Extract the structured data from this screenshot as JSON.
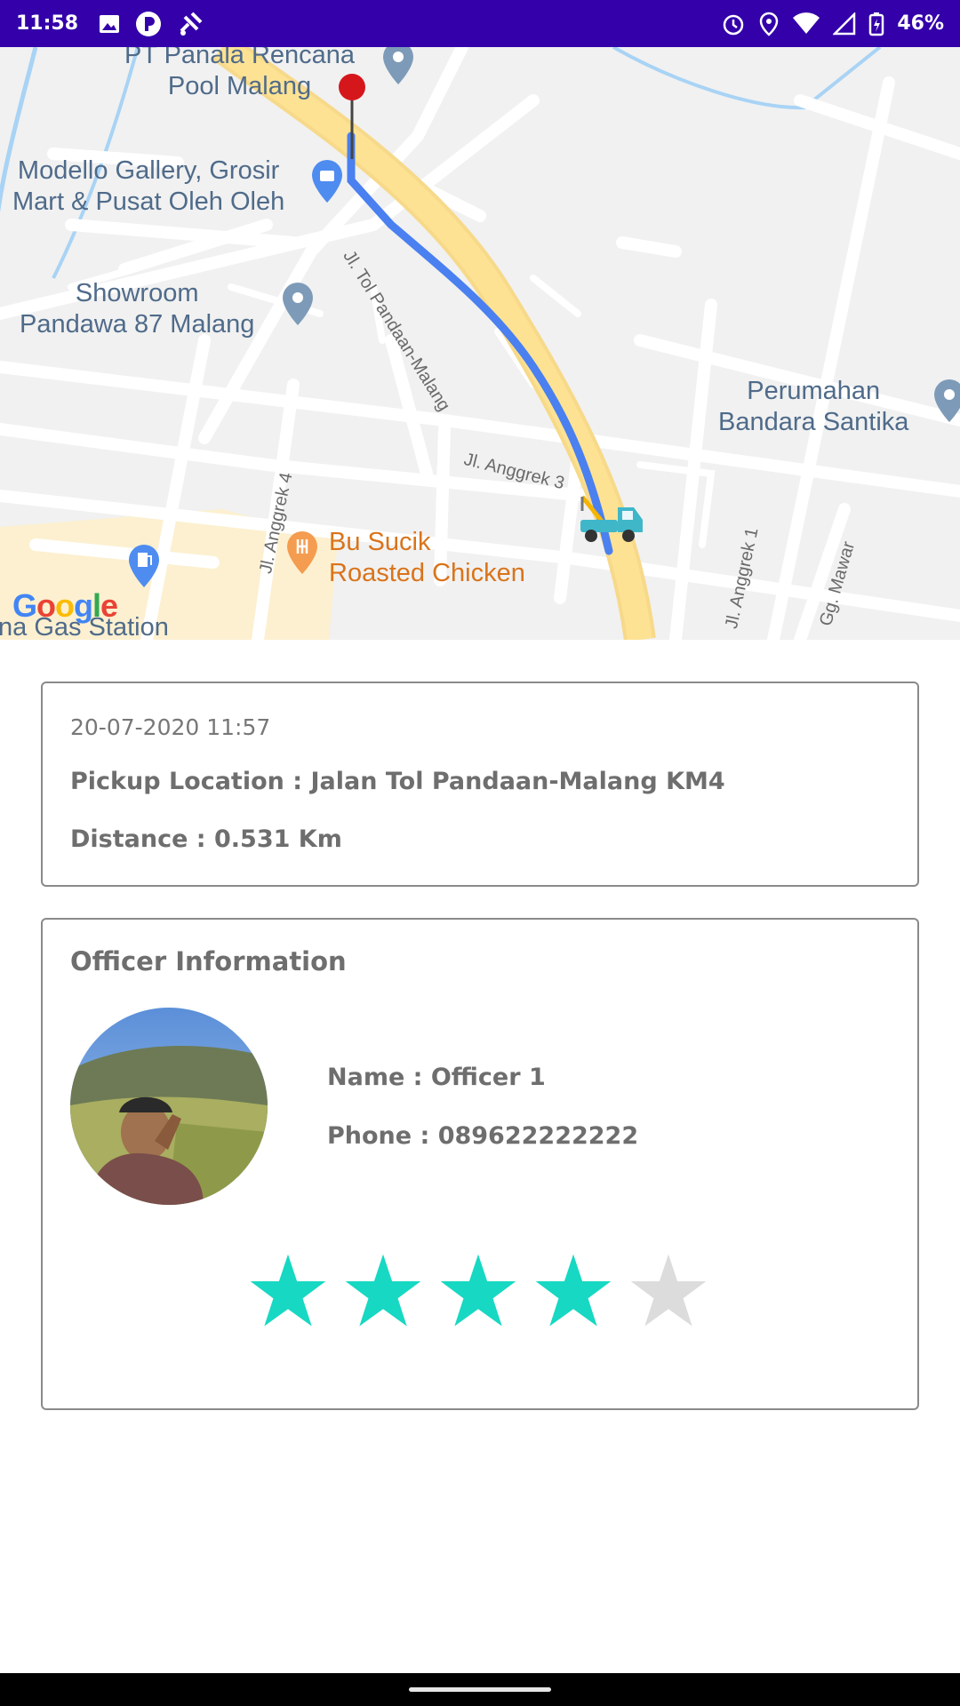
{
  "status_bar": {
    "time": "11:58",
    "battery": "46%",
    "left_icons": [
      "image-icon",
      "p-app-icon",
      "fake-gps-icon"
    ],
    "right_icons": [
      "alarm-icon",
      "location-icon",
      "wifi-icon",
      "signal-icon",
      "battery-icon"
    ],
    "background": "#3300aa"
  },
  "map": {
    "labels": {
      "pool": "PT Panala Rencana\nPool Malang",
      "gallery": "Modello Gallery, Grosir\nMart & Pusat Oleh Oleh",
      "showroom": "Showroom\nPandawa 87 Malang",
      "perumahan": "Perumahan\nBandara Santika",
      "restaurant": "Bu Sucik\nRoasted Chicken",
      "gas": "na Gas Station"
    },
    "streets": {
      "toll": "Jl. Tol Pandaan-Malang",
      "anggrek3": "Jl. Anggrek 3",
      "anggrek4": "Jl. Anggrek 4",
      "anggrek1": "Jl. Anggrek 1",
      "mawar": "Gg. Mawar"
    },
    "logo": [
      "G",
      "o",
      "o",
      "g",
      "l",
      "e"
    ],
    "route_color": "#4a80f0",
    "road_highlight": "#fde293",
    "destination_pin_color": "#d5171c"
  },
  "trip": {
    "date": "20-07-2020 11:57",
    "pickup": "Pickup Location : Jalan Tol Pandaan-Malang KM4",
    "distance": "Distance : 0.531 Km"
  },
  "officer": {
    "title": "Officer Information",
    "name": "Name : Officer 1",
    "phone": "Phone : 089622222222",
    "rating": 4,
    "rating_max": 5,
    "star_color": "#17d8c2",
    "star_empty_color": "#dcdcdc"
  }
}
